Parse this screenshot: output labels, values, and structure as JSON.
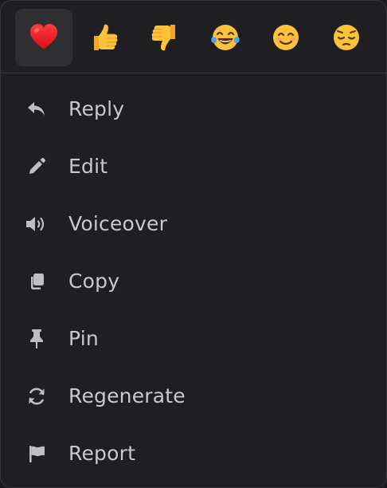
{
  "colors": {
    "menu_background": "#1f1f21",
    "border": "#38383b",
    "selected_reaction_background": "#2f2f32",
    "text": "#c9c9cc",
    "icon": "#bfbfc2"
  },
  "reactions": [
    {
      "name": "red-heart",
      "selected": true
    },
    {
      "name": "thumbs-up",
      "selected": false
    },
    {
      "name": "thumbs-down",
      "selected": false
    },
    {
      "name": "face-with-tears-of-joy",
      "selected": false
    },
    {
      "name": "smiling-face-with-smiling-eyes",
      "selected": false
    },
    {
      "name": "pensive-face",
      "selected": false
    }
  ],
  "menu": {
    "items": [
      {
        "label": "Reply",
        "icon": "reply-icon"
      },
      {
        "label": "Edit",
        "icon": "pencil-icon"
      },
      {
        "label": "Voiceover",
        "icon": "speaker-icon"
      },
      {
        "label": "Copy",
        "icon": "copy-icon"
      },
      {
        "label": "Pin",
        "icon": "pin-icon"
      },
      {
        "label": "Regenerate",
        "icon": "refresh-icon"
      },
      {
        "label": "Report",
        "icon": "flag-icon"
      }
    ]
  }
}
